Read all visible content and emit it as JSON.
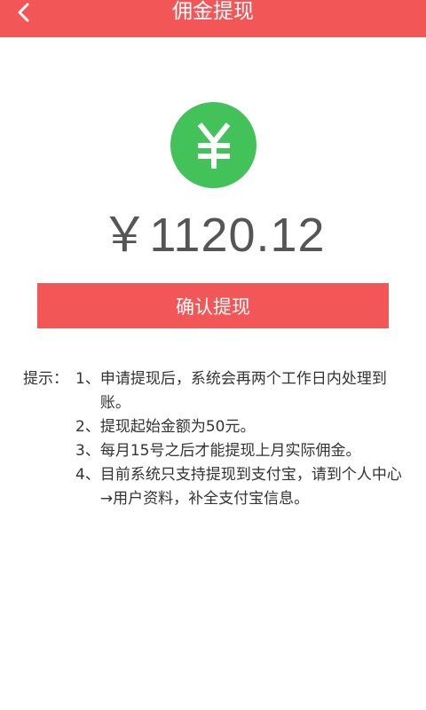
{
  "header": {
    "title": "佣金提现",
    "back_icon": "chevron-left-icon",
    "background": "#f25656"
  },
  "balance": {
    "currency_icon": "yen-icon",
    "badge_color": "#43c25a",
    "amount": "￥1120.12"
  },
  "confirm": {
    "label": "确认提现"
  },
  "tips": {
    "label": "提示：",
    "items": [
      {
        "num": "1、",
        "text": "申请提现后，系统会再两个工作日内处理到账。"
      },
      {
        "num": "2、",
        "text": "提现起始金额为50元。"
      },
      {
        "num": "3、",
        "text": "每月15号之后才能提现上月实际佣金。"
      },
      {
        "num": "4、",
        "text": "目前系统只支持提现到支付宝，请到个人中心→用户资料，补全支付宝信息。"
      }
    ]
  }
}
